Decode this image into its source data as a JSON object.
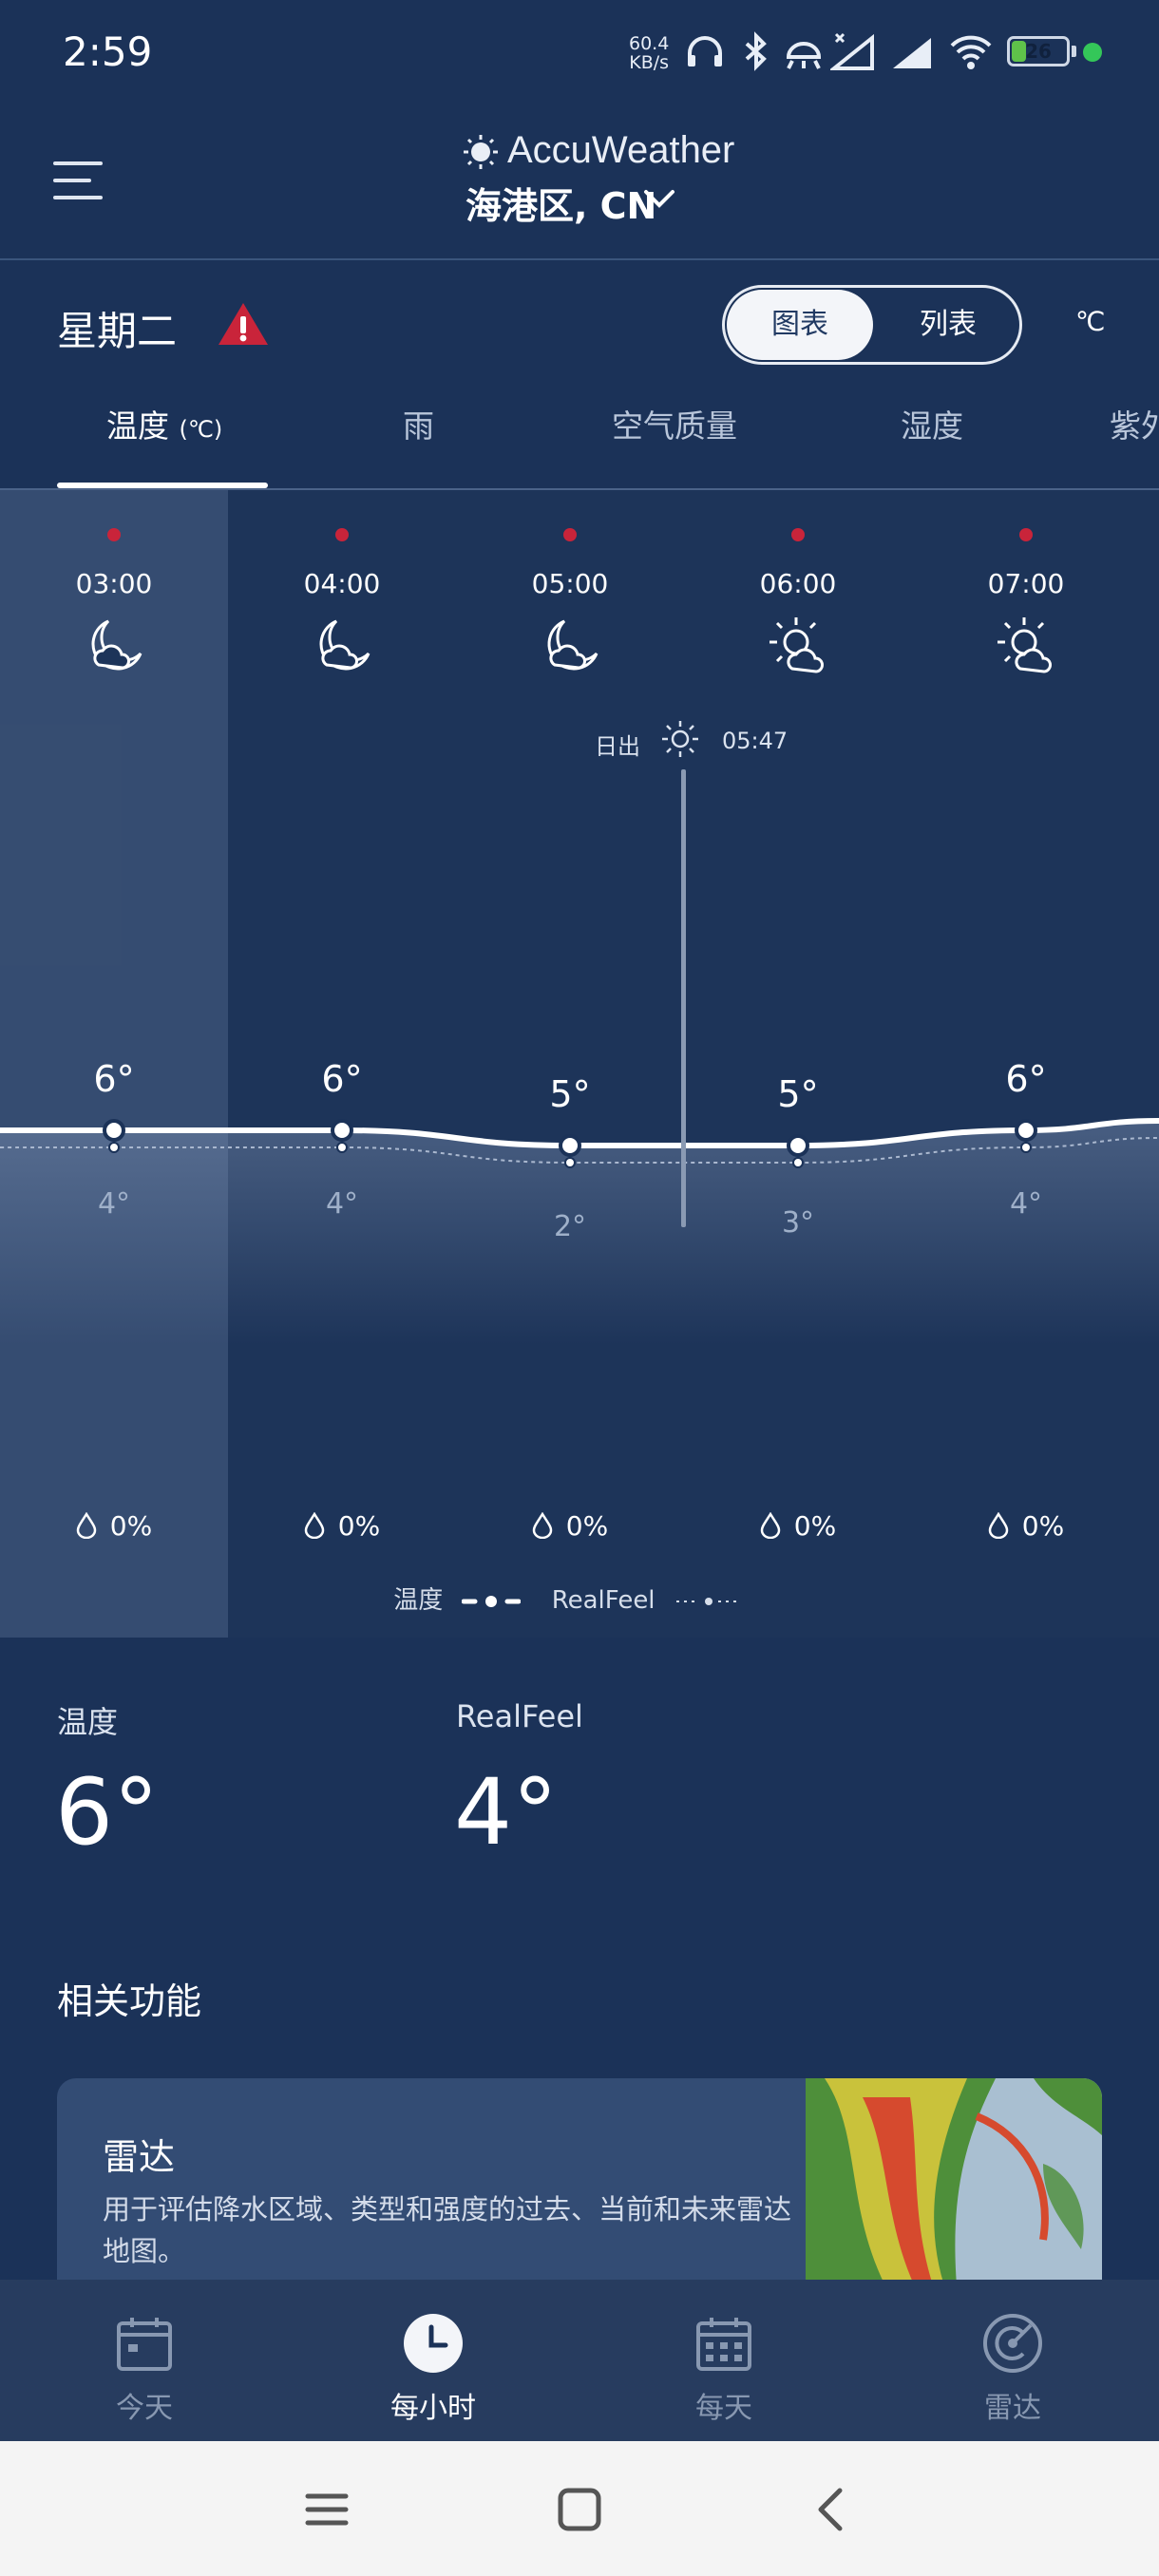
{
  "status_bar": {
    "time": "2:59",
    "net_speed_value": "60.4",
    "net_speed_unit": "KB/s",
    "battery_level": "26",
    "battery_fraction": 0.26
  },
  "header": {
    "brand": "AccuWeather",
    "location": "海港区, CN"
  },
  "day": {
    "label": "星期二",
    "toggle_chart": "图表",
    "toggle_list": "列表",
    "unit": "℃"
  },
  "tabs": {
    "temperature": "温度",
    "temperature_unit": "(℃)",
    "rain": "雨",
    "air_quality": "空气质量",
    "humidity": "湿度",
    "uv": "紫外"
  },
  "hours": [
    {
      "time": "03:00",
      "icon": "moon-cloud-icon",
      "temp": "6°",
      "realfeel": "4°",
      "precip": "0%",
      "temp_value": 6,
      "realfeel_value": 4
    },
    {
      "time": "04:00",
      "icon": "moon-cloud-icon",
      "temp": "6°",
      "realfeel": "4°",
      "precip": "0%",
      "temp_value": 6,
      "realfeel_value": 4
    },
    {
      "time": "05:00",
      "icon": "moon-cloud-icon",
      "temp": "5°",
      "realfeel": "2°",
      "precip": "0%",
      "temp_value": 5,
      "realfeel_value": 2
    },
    {
      "time": "06:00",
      "icon": "sun-cloud-icon",
      "temp": "5°",
      "realfeel": "3°",
      "precip": "0%",
      "temp_value": 5,
      "realfeel_value": 3
    },
    {
      "time": "07:00",
      "icon": "sun-cloud-icon",
      "temp": "6°",
      "realfeel": "4°",
      "precip": "0%",
      "temp_value": 6,
      "realfeel_value": 4
    }
  ],
  "sunrise": {
    "label": "日出",
    "time": "05:47"
  },
  "legend": {
    "temperature": "温度",
    "realfeel": "RealFeel"
  },
  "current": {
    "temp_label": "温度",
    "temp_value": "6°",
    "realfeel_label": "RealFeel",
    "realfeel_value": "4°"
  },
  "related": {
    "title": "相关功能",
    "radar_title": "雷达",
    "radar_desc": "用于评估降水区域、类型和强度的过去、当前和未来雷达地图。"
  },
  "bottom_nav": {
    "today": "今天",
    "hourly": "每小时",
    "daily": "每天",
    "radar": "雷达"
  },
  "colors": {
    "background": "#1b3258",
    "alert": "#c9243a",
    "battery": "#5fc24a"
  }
}
